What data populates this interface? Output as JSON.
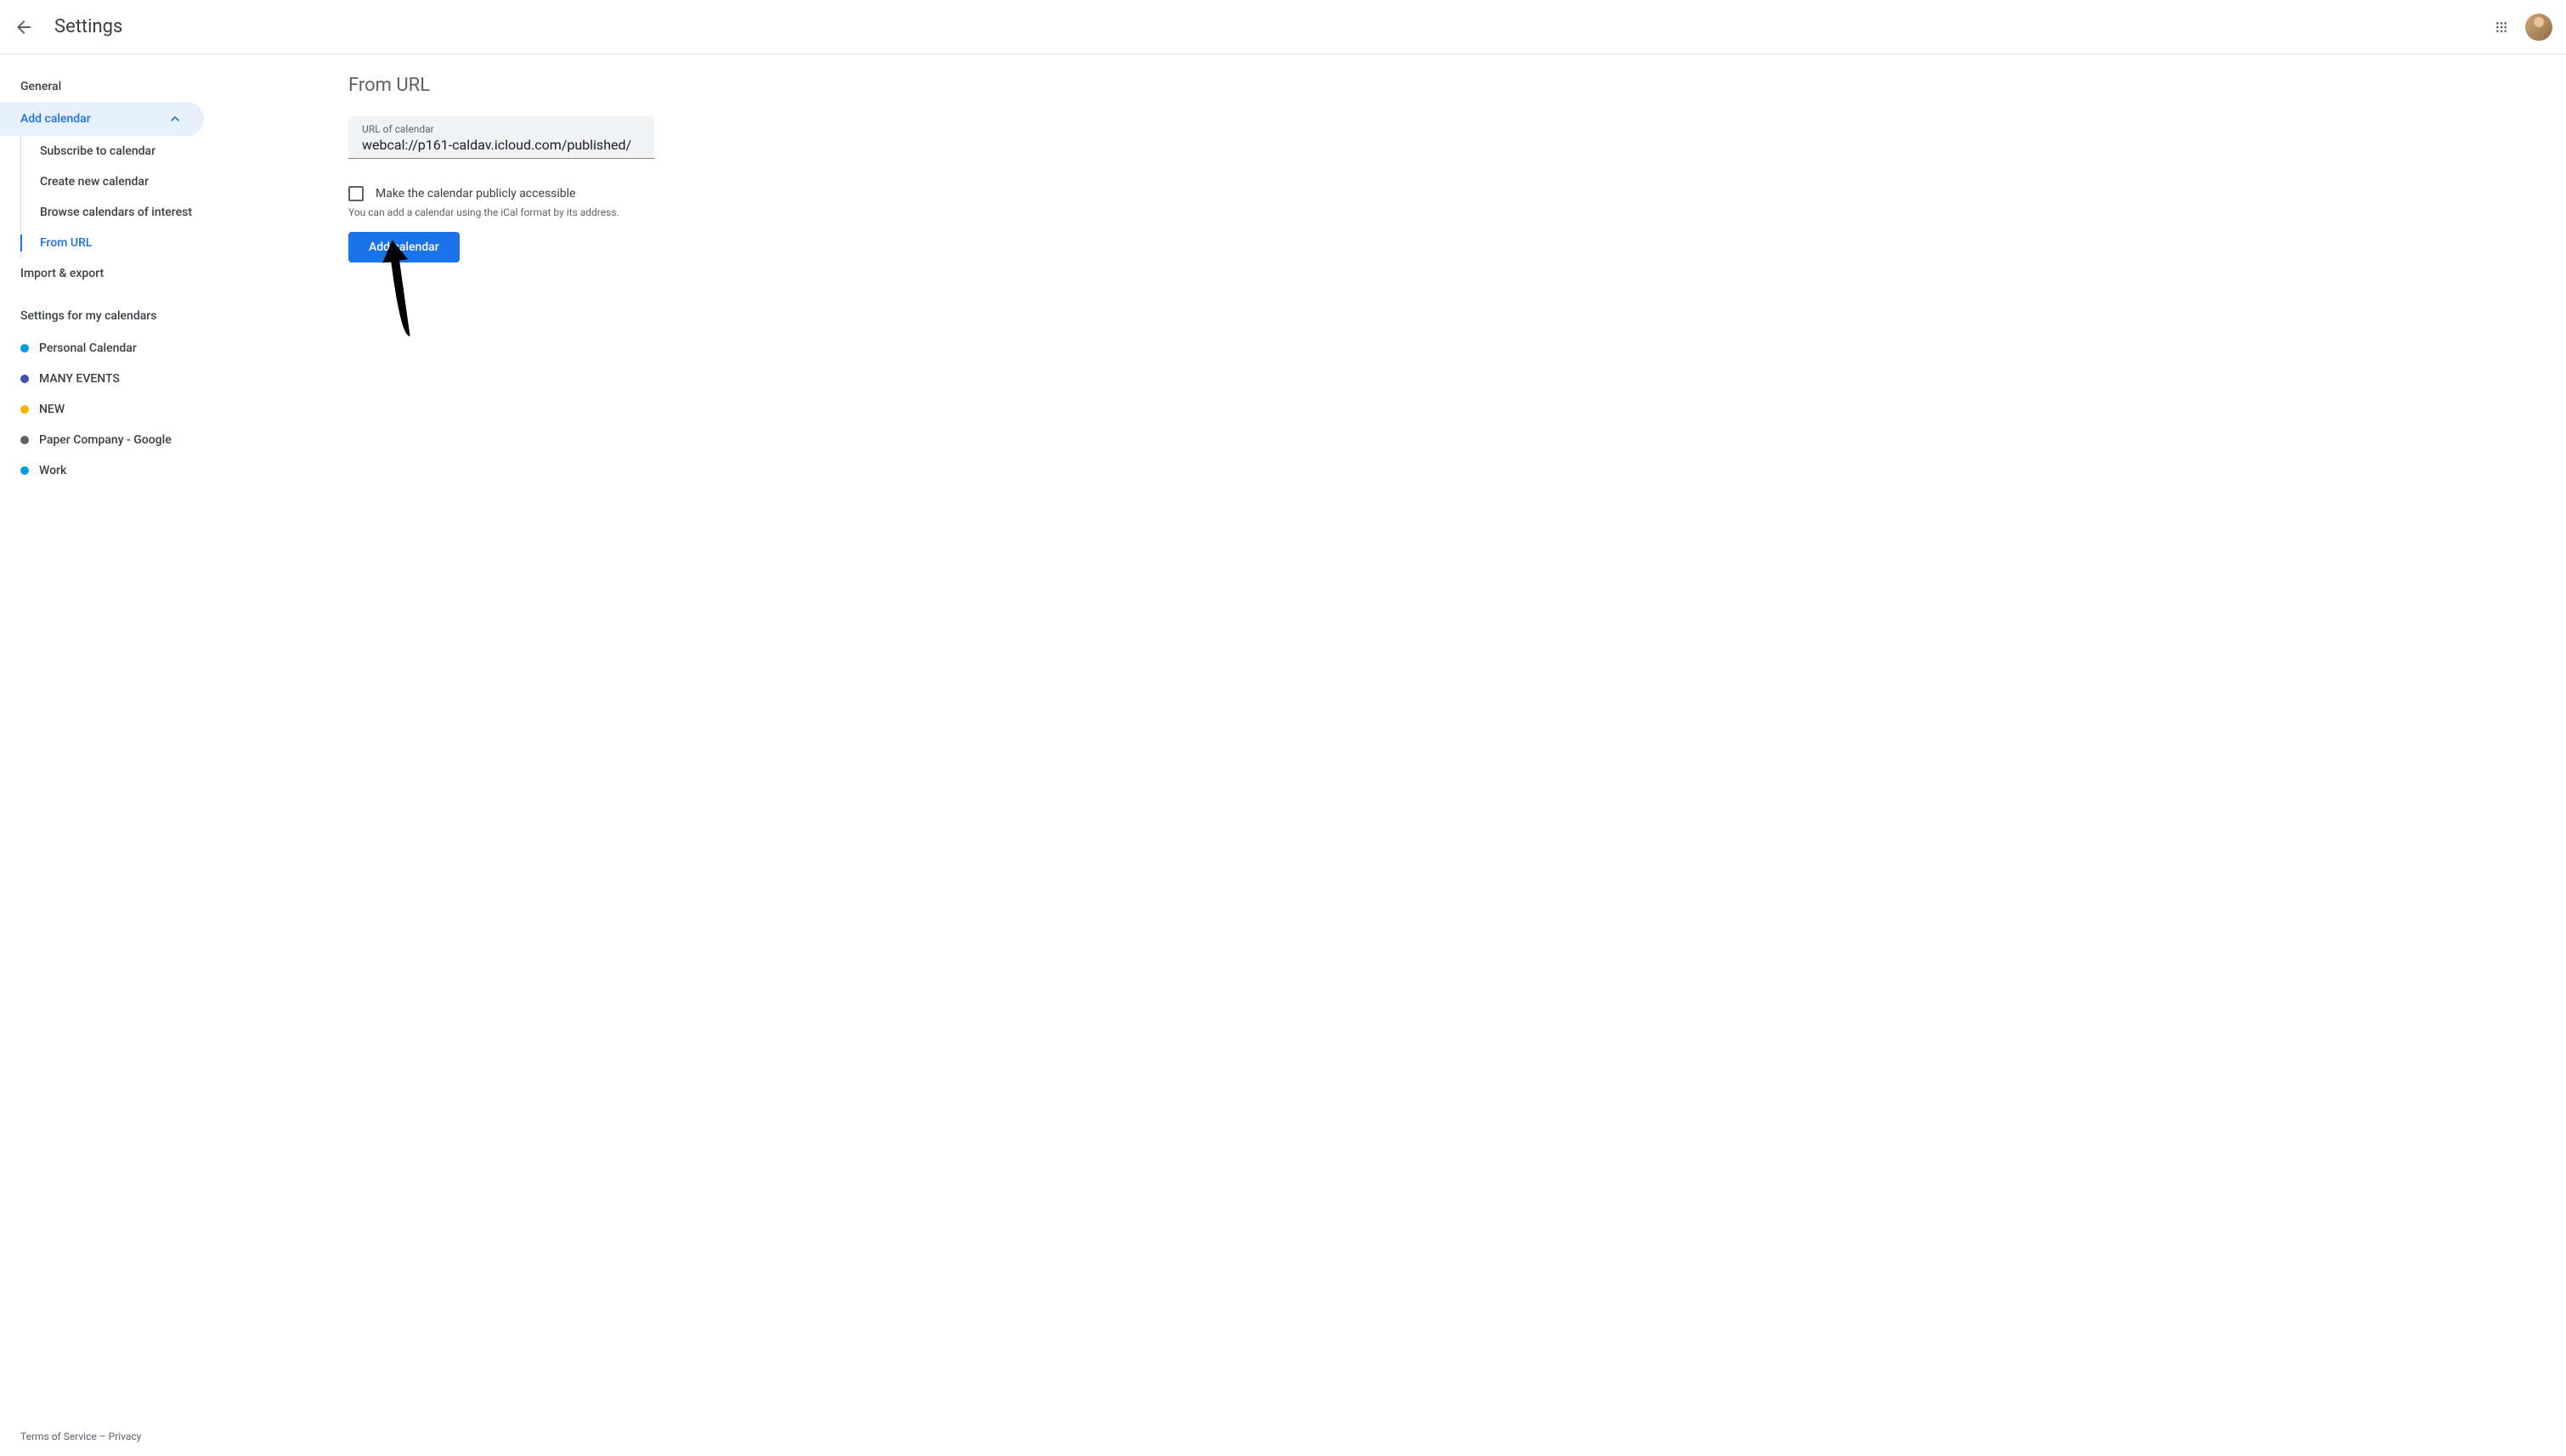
{
  "header": {
    "title": "Settings"
  },
  "sidebar": {
    "general": "General",
    "add_calendar": "Add calendar",
    "sub_items": {
      "subscribe": "Subscribe to calendar",
      "create": "Create new calendar",
      "browse": "Browse calendars of interest",
      "from_url": "From URL"
    },
    "import_export": "Import & export",
    "section_heading": "Settings for my calendars",
    "calendars": [
      {
        "label": "Personal Calendar",
        "color": "#039be5"
      },
      {
        "label": "MANY EVENTS",
        "color": "#3f51b5"
      },
      {
        "label": "NEW",
        "color": "#f4b400"
      },
      {
        "label": "Paper Company - Google",
        "color": "#616161"
      },
      {
        "label": "Work",
        "color": "#039be5"
      }
    ]
  },
  "main": {
    "title": "From URL",
    "input_label": "URL of calendar",
    "input_value": "webcal://p161-caldav.icloud.com/published/",
    "checkbox_label": "Make the calendar publicly accessible",
    "hint_text": "You can add a calendar using the iCal format by its address.",
    "button_label": "Add calendar"
  },
  "footer": {
    "terms": "Terms of Service",
    "separator": " – ",
    "privacy": "Privacy"
  }
}
